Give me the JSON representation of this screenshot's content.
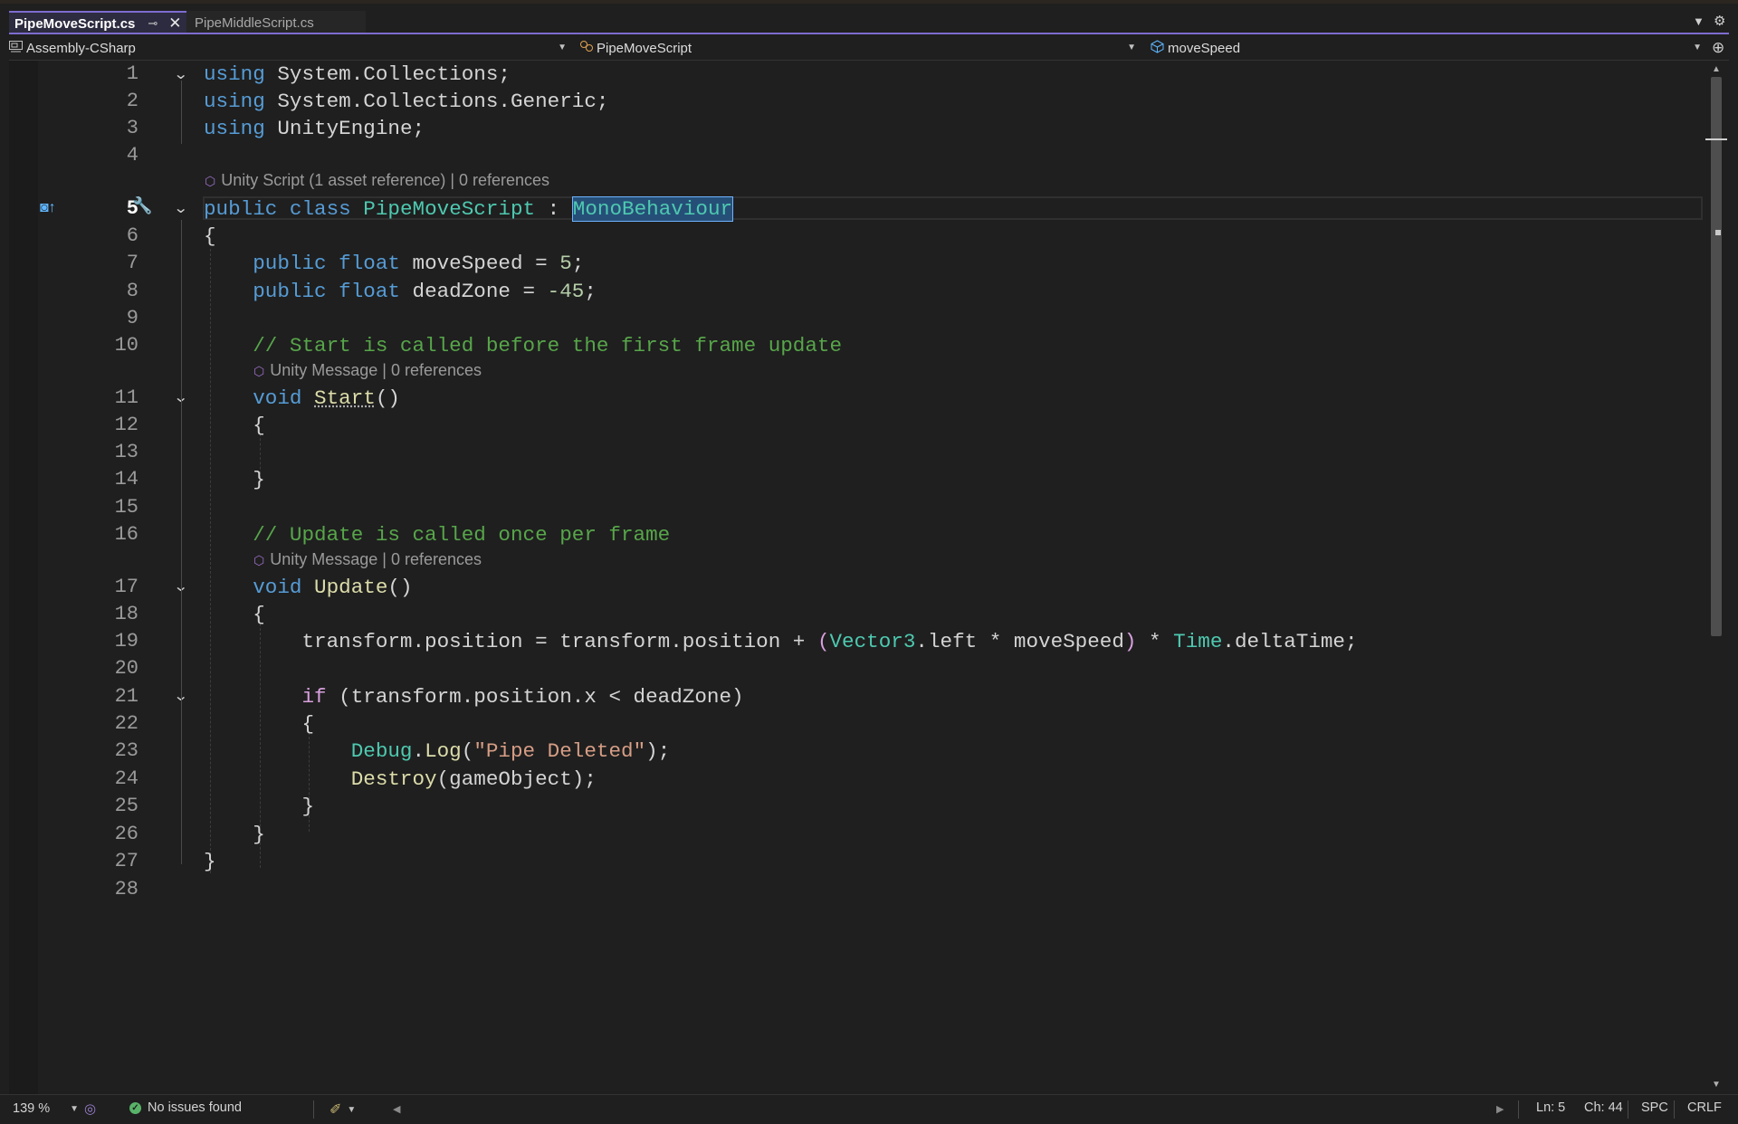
{
  "tabs": [
    {
      "label": "PipeMoveScript.cs",
      "active": true
    },
    {
      "label": "PipeMiddleScript.cs",
      "active": false
    }
  ],
  "tab_icons": {
    "pin": "pin-icon",
    "close": "close-icon"
  },
  "navbar": {
    "project": "Assembly-CSharp",
    "type": "PipeMoveScript",
    "member": "moveSpeed"
  },
  "editor": {
    "line_numbers": [
      "1",
      "2",
      "3",
      "4",
      "5",
      "6",
      "7",
      "8",
      "9",
      "10",
      "11",
      "12",
      "13",
      "14",
      "15",
      "16",
      "17",
      "18",
      "19",
      "20",
      "21",
      "22",
      "23",
      "24",
      "25",
      "26",
      "27",
      "28"
    ],
    "current_line": "5",
    "codelens": {
      "class": "Unity Script (1 asset reference) | 0 references",
      "start": "Unity Message | 0 references",
      "update": "Unity Message | 0 references"
    }
  },
  "code": {
    "l1_kw": "using",
    "l1_rest": " System.Collections;",
    "l2_kw": "using",
    "l2_rest": " System.Collections.Generic;",
    "l3_kw": "using",
    "l3_rest": " UnityEngine;",
    "l5_public": "public",
    "l5_class": "class",
    "l5_name": "PipeMoveScript",
    "l5_colon": " : ",
    "l5_base": "MonoBehaviour",
    "l6": "{",
    "l7_public": "public",
    "l7_float": "float",
    "l7_rest": " moveSpeed = ",
    "l7_num": "5",
    "l7_end": ";",
    "l8_public": "public",
    "l8_float": "float",
    "l8_rest": " deadZone = ",
    "l8_num": "-45",
    "l8_end": ";",
    "l10_comment": "// Start is called before the first frame update",
    "l11_void": "void",
    "l11_fn": "Start",
    "l11_end": "()",
    "l12": "{",
    "l14": "}",
    "l16_comment": "// Update is called once per frame",
    "l17_void": "void",
    "l17_fn": "Update",
    "l17_end": "()",
    "l18": "{",
    "l19_a": "transform.position = transform.position + ",
    "l19_p1": "(",
    "l19_vec": "Vector3",
    "l19_b": ".left * moveSpeed",
    "l19_p2": ")",
    "l19_c": " * ",
    "l19_time": "Time",
    "l19_d": ".deltaTime;",
    "l21_if": "if",
    "l21_rest": " (transform.position.x < deadZone)",
    "l22": "{",
    "l23_debug": "Debug",
    "l23_dot": ".",
    "l23_log": "Log",
    "l23_p1": "(",
    "l23_str": "\"Pipe Deleted\"",
    "l23_p2": ");",
    "l24_fn": "Destroy",
    "l24_rest": "(gameObject);",
    "l25": "}",
    "l26": "}",
    "l27": "}"
  },
  "statusbar": {
    "zoom": "139 %",
    "issues": "No issues found",
    "line": "Ln: 5",
    "char": "Ch: 44",
    "whitespace": "SPC",
    "line_ending": "CRLF"
  },
  "colors": {
    "keyword": "#569cd6",
    "type": "#4ec9b0",
    "method": "#dcdcaa",
    "comment": "#57a64a",
    "string": "#d69d85",
    "number": "#b5cea8",
    "control": "#d8a0df",
    "tab_accent": "#7e6ccf"
  }
}
